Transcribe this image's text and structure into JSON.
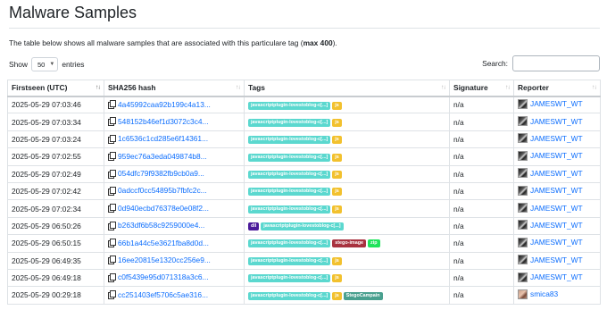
{
  "page": {
    "title": "Malware Samples",
    "intro_prefix": "The table below shows all malware samples that are associated with this particulare tag (",
    "intro_bold": "max 400",
    "intro_suffix": ")."
  },
  "controls": {
    "show_label": "Show",
    "entries_value": "50",
    "entries_label": "entries",
    "search_label": "Search:",
    "search_value": ""
  },
  "table": {
    "columns": [
      "Firstseen (UTC)",
      "SHA256 hash",
      "Tags",
      "Signature",
      "Reporter"
    ],
    "rows": [
      {
        "firstseen": "2025-05-29 07:03:46",
        "hash": "4a45992caa92b199c4a13...",
        "tags": [
          {
            "text": "javascriptplugin-lovestoblog-c[...]",
            "style": "teal"
          },
          {
            "text": "js",
            "style": "yellow"
          }
        ],
        "signature": "n/a",
        "reporter": "JAMESWT_WT",
        "avatar": "dark"
      },
      {
        "firstseen": "2025-05-29 07:03:34",
        "hash": "548152b46ef1d3072c3c4...",
        "tags": [
          {
            "text": "javascriptplugin-lovestoblog-c[...]",
            "style": "teal"
          },
          {
            "text": "js",
            "style": "yellow"
          }
        ],
        "signature": "n/a",
        "reporter": "JAMESWT_WT",
        "avatar": "dark"
      },
      {
        "firstseen": "2025-05-29 07:03:24",
        "hash": "1c6536c1cd285e6f14361...",
        "tags": [
          {
            "text": "javascriptplugin-lovestoblog-c[...]",
            "style": "teal"
          },
          {
            "text": "js",
            "style": "yellow"
          }
        ],
        "signature": "n/a",
        "reporter": "JAMESWT_WT",
        "avatar": "dark"
      },
      {
        "firstseen": "2025-05-29 07:02:55",
        "hash": "959ec76a3eda049874b8...",
        "tags": [
          {
            "text": "javascriptplugin-lovestoblog-c[...]",
            "style": "teal"
          },
          {
            "text": "js",
            "style": "yellow"
          }
        ],
        "signature": "n/a",
        "reporter": "JAMESWT_WT",
        "avatar": "dark"
      },
      {
        "firstseen": "2025-05-29 07:02:49",
        "hash": "054dfc79f9382fb9cb0a9...",
        "tags": [
          {
            "text": "javascriptplugin-lovestoblog-c[...]",
            "style": "teal"
          },
          {
            "text": "js",
            "style": "yellow"
          }
        ],
        "signature": "n/a",
        "reporter": "JAMESWT_WT",
        "avatar": "dark"
      },
      {
        "firstseen": "2025-05-29 07:02:42",
        "hash": "0adccf0cc54895b7fbfc2c...",
        "tags": [
          {
            "text": "javascriptplugin-lovestoblog-c[...]",
            "style": "teal"
          },
          {
            "text": "js",
            "style": "yellow"
          }
        ],
        "signature": "n/a",
        "reporter": "JAMESWT_WT",
        "avatar": "dark"
      },
      {
        "firstseen": "2025-05-29 07:02:34",
        "hash": "0d940ecbd76378e0e08f2...",
        "tags": [
          {
            "text": "javascriptplugin-lovestoblog-c[...]",
            "style": "teal"
          },
          {
            "text": "js",
            "style": "yellow"
          }
        ],
        "signature": "n/a",
        "reporter": "JAMESWT_WT",
        "avatar": "dark"
      },
      {
        "firstseen": "2025-05-29 06:50:26",
        "hash": "b263df6b58c9259000e4...",
        "tags": [
          {
            "text": "dll",
            "style": "purple"
          },
          {
            "text": "javascriptplugin-lovestoblog-c[...]",
            "style": "teal"
          }
        ],
        "signature": "n/a",
        "reporter": "JAMESWT_WT",
        "avatar": "dark"
      },
      {
        "firstseen": "2025-05-29 06:50:15",
        "hash": "66b1a44c5e3621fba8d0d...",
        "tags": [
          {
            "text": "javascriptplugin-lovestoblog-c[...]",
            "style": "teal"
          },
          {
            "text": "stego-image",
            "style": "maroon"
          },
          {
            "text": "zip",
            "style": "green"
          }
        ],
        "signature": "n/a",
        "reporter": "JAMESWT_WT",
        "avatar": "dark"
      },
      {
        "firstseen": "2025-05-29 06:49:35",
        "hash": "16ee20815e1320cc256e9...",
        "tags": [
          {
            "text": "javascriptplugin-lovestoblog-c[...]",
            "style": "teal"
          },
          {
            "text": "js",
            "style": "yellow"
          }
        ],
        "signature": "n/a",
        "reporter": "JAMESWT_WT",
        "avatar": "dark"
      },
      {
        "firstseen": "2025-05-29 06:49:18",
        "hash": "c0f5439e95d071318a3c6...",
        "tags": [
          {
            "text": "javascriptplugin-lovestoblog-c[...]",
            "style": "teal"
          },
          {
            "text": "js",
            "style": "yellow"
          }
        ],
        "signature": "n/a",
        "reporter": "JAMESWT_WT",
        "avatar": "dark"
      },
      {
        "firstseen": "2025-05-29 00:29:18",
        "hash": "cc251403ef5706c5ae316...",
        "tags": [
          {
            "text": "javascriptplugin-lovestoblog-c[...]",
            "style": "teal"
          },
          {
            "text": "js",
            "style": "yellow"
          },
          {
            "text": "StegoCampain",
            "style": "gray"
          }
        ],
        "signature": "n/a",
        "reporter": "smica83",
        "avatar": "alt"
      }
    ]
  },
  "icons": {
    "copy": "copy-icon",
    "sort": "sort-icon",
    "avatar": "avatar"
  }
}
